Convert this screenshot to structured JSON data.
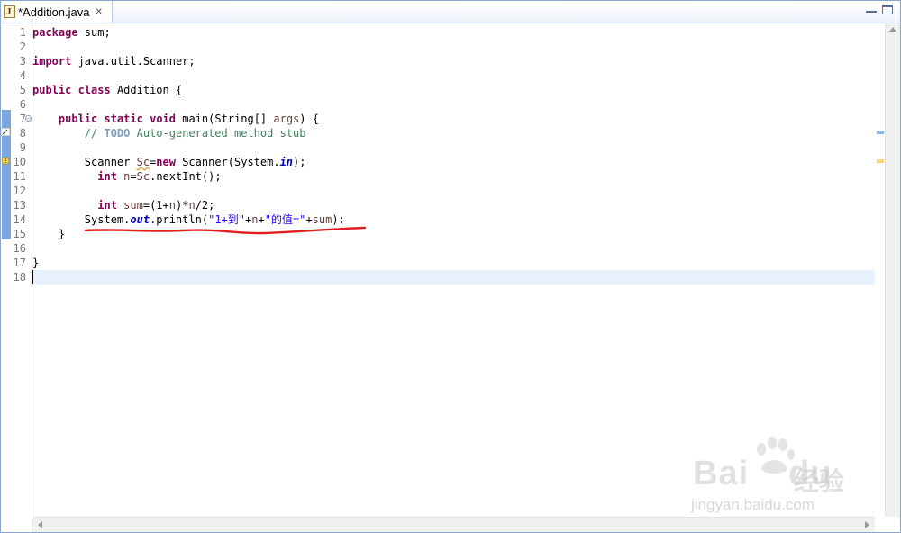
{
  "tab": {
    "title": "*Addition.java",
    "close_label": "✕",
    "icon": "java-file-icon"
  },
  "code_lines": [
    {
      "num": "1",
      "segments": [
        {
          "t": "kw",
          "v": "package"
        },
        {
          "t": "p",
          "v": " sum;"
        }
      ]
    },
    {
      "num": "2",
      "segments": []
    },
    {
      "num": "3",
      "segments": [
        {
          "t": "kw",
          "v": "import"
        },
        {
          "t": "p",
          "v": " java.util.Scanner;"
        }
      ]
    },
    {
      "num": "4",
      "segments": []
    },
    {
      "num": "5",
      "segments": [
        {
          "t": "kw",
          "v": "public"
        },
        {
          "t": "p",
          "v": " "
        },
        {
          "t": "kw",
          "v": "class"
        },
        {
          "t": "p",
          "v": " Addition {"
        }
      ]
    },
    {
      "num": "6",
      "segments": []
    },
    {
      "num": "7",
      "segments": [
        {
          "t": "p",
          "v": "    "
        },
        {
          "t": "kw",
          "v": "public"
        },
        {
          "t": "p",
          "v": " "
        },
        {
          "t": "kw",
          "v": "static"
        },
        {
          "t": "p",
          "v": " "
        },
        {
          "t": "kw",
          "v": "void"
        },
        {
          "t": "p",
          "v": " main(String[] "
        },
        {
          "t": "var",
          "v": "args"
        },
        {
          "t": "p",
          "v": ") {"
        }
      ]
    },
    {
      "num": "8",
      "segments": [
        {
          "t": "p",
          "v": "        "
        },
        {
          "t": "cm",
          "v": "// "
        },
        {
          "t": "todo",
          "v": "TODO"
        },
        {
          "t": "cm",
          "v": " Auto-generated method stub"
        }
      ]
    },
    {
      "num": "9",
      "segments": []
    },
    {
      "num": "10",
      "segments": [
        {
          "t": "p",
          "v": "        Scanner "
        },
        {
          "t": "warnvar",
          "v": "Sc"
        },
        {
          "t": "p",
          "v": "="
        },
        {
          "t": "kw",
          "v": "new"
        },
        {
          "t": "p",
          "v": " Scanner(System."
        },
        {
          "t": "fld",
          "v": "in"
        },
        {
          "t": "p",
          "v": ");"
        }
      ]
    },
    {
      "num": "11",
      "segments": [
        {
          "t": "p",
          "v": "          "
        },
        {
          "t": "kw",
          "v": "int"
        },
        {
          "t": "p",
          "v": " "
        },
        {
          "t": "var",
          "v": "n"
        },
        {
          "t": "p",
          "v": "="
        },
        {
          "t": "var",
          "v": "Sc"
        },
        {
          "t": "p",
          "v": ".nextInt();"
        }
      ]
    },
    {
      "num": "12",
      "segments": []
    },
    {
      "num": "13",
      "segments": [
        {
          "t": "p",
          "v": "          "
        },
        {
          "t": "kw",
          "v": "int"
        },
        {
          "t": "p",
          "v": " "
        },
        {
          "t": "var",
          "v": "sum"
        },
        {
          "t": "p",
          "v": "=(1+"
        },
        {
          "t": "var",
          "v": "n"
        },
        {
          "t": "p",
          "v": ")*"
        },
        {
          "t": "var",
          "v": "n"
        },
        {
          "t": "p",
          "v": "/2;"
        }
      ]
    },
    {
      "num": "14",
      "segments": [
        {
          "t": "p",
          "v": "        System."
        },
        {
          "t": "fld",
          "v": "out"
        },
        {
          "t": "p",
          "v": ".println("
        },
        {
          "t": "str",
          "v": "\"1+到\""
        },
        {
          "t": "p",
          "v": "+"
        },
        {
          "t": "var",
          "v": "n"
        },
        {
          "t": "p",
          "v": "+"
        },
        {
          "t": "str",
          "v": "\"的值=\""
        },
        {
          "t": "p",
          "v": "+"
        },
        {
          "t": "var",
          "v": "sum"
        },
        {
          "t": "p",
          "v": ");"
        }
      ]
    },
    {
      "num": "15",
      "segments": [
        {
          "t": "p",
          "v": "    }"
        }
      ]
    },
    {
      "num": "16",
      "segments": []
    },
    {
      "num": "17",
      "segments": [
        {
          "t": "p",
          "v": "}"
        }
      ]
    },
    {
      "num": "18",
      "segments": [],
      "current": true
    }
  ],
  "colors": {
    "keyword": "#7f0055",
    "comment": "#3f7f5f",
    "todo": "#7f9fbf",
    "string": "#2a00ff",
    "static_field": "#0000c0",
    "local_var": "#6a3e3e",
    "current_line": "#e8f2fe",
    "annotation": "#e02020"
  },
  "watermark": {
    "brand": "Bai",
    "brand_suffix": "du",
    "brand_cn": "经验",
    "url": "jingyan.baidu.com"
  }
}
